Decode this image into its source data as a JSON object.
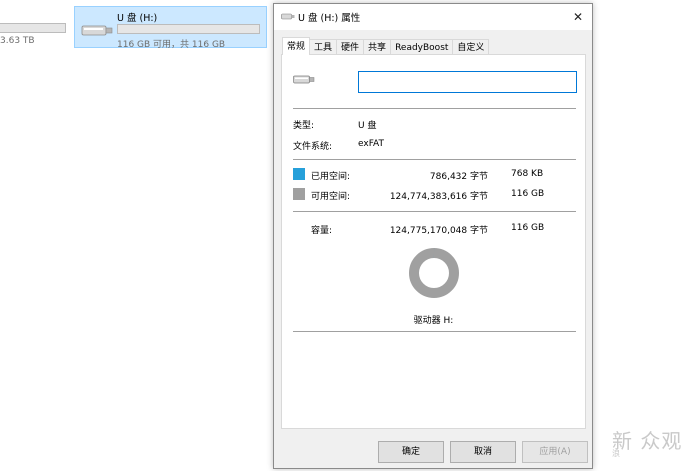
{
  "explorer": {
    "left_drive_free": "3.63 TB",
    "drive_name": "U 盘 (H:)",
    "drive_free": "116 GB 可用，共 116 GB",
    "drive_used_fraction": 0.0
  },
  "dialog": {
    "title": "U 盘 (H:) 属性",
    "close_label": "✕",
    "tabs": [
      "常规",
      "工具",
      "硬件",
      "共享",
      "ReadyBoost",
      "自定义"
    ],
    "name_value": "",
    "type_label": "类型:",
    "type_value": "U 盘",
    "fs_label": "文件系统:",
    "fs_value": "exFAT",
    "used": {
      "label": "已用空间:",
      "bytes": "786,432 字节",
      "size": "768 KB",
      "color": "#26a0da"
    },
    "free": {
      "label": "可用空间:",
      "bytes": "124,774,383,616 字节",
      "size": "116 GB",
      "color": "#a0a0a0"
    },
    "capacity": {
      "label": "容量:",
      "bytes": "124,775,170,048 字节",
      "size": "116 GB"
    },
    "drive_letter_label": "驱动器 H:",
    "buttons": {
      "ok": "确定",
      "cancel": "取消",
      "apply": "应用(A)"
    }
  },
  "watermark": {
    "main": "新 众观",
    "sub": "浪"
  }
}
